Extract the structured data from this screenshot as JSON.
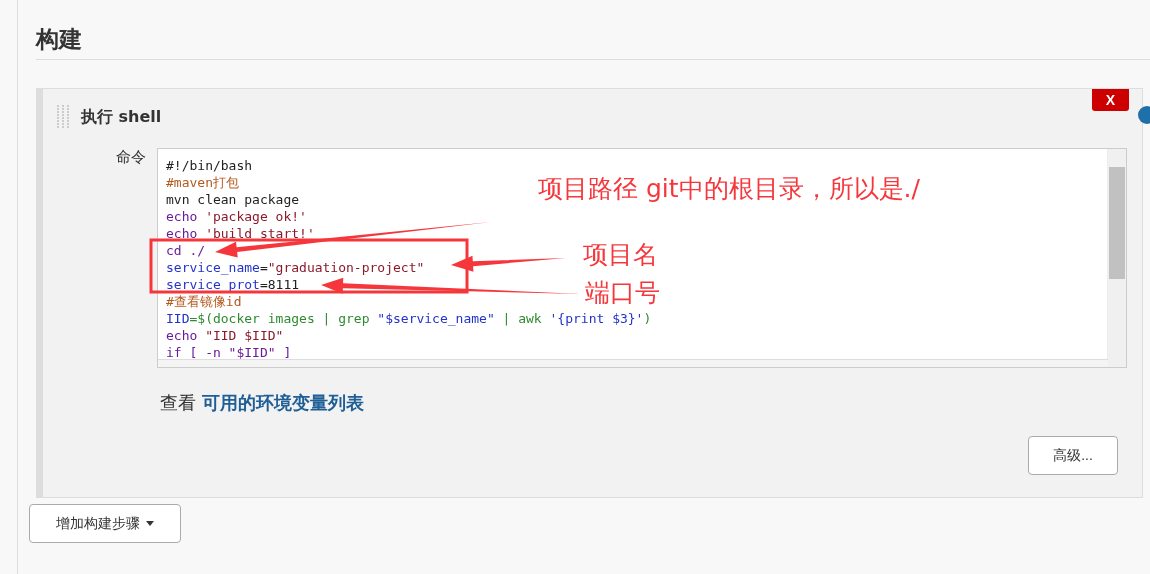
{
  "section": {
    "title": "构建"
  },
  "step": {
    "title": "执行 shell",
    "delete_label": "X",
    "command_label": "命令",
    "code": [
      [
        {
          "text": "#!/bin/bash",
          "kind": "plain"
        }
      ],
      [
        {
          "text": "#maven打包",
          "kind": "comment"
        }
      ],
      [
        {
          "text": "mvn clean package",
          "kind": "plain"
        }
      ],
      [
        {
          "text": "echo ",
          "kind": "keyword"
        },
        {
          "text": "'package ok!'",
          "kind": "string"
        }
      ],
      [
        {
          "text": "echo ",
          "kind": "keyword"
        },
        {
          "text": "'build start!'",
          "kind": "string"
        }
      ],
      [
        {
          "text": "cd ./",
          "kind": "keyword"
        }
      ],
      [
        {
          "text": "service_name",
          "kind": "variable"
        },
        {
          "text": "=",
          "kind": "plain"
        },
        {
          "text": "\"graduation-project\"",
          "kind": "string"
        }
      ],
      [
        {
          "text": "service_prot",
          "kind": "variable"
        },
        {
          "text": "=8111",
          "kind": "plain"
        }
      ],
      [
        {
          "text": "#查看镜像id",
          "kind": "comment"
        }
      ],
      [
        {
          "text": "IID",
          "kind": "variable"
        },
        {
          "text": "=$(docker images | grep ",
          "kind": "command"
        },
        {
          "text": "\"$service_name\"",
          "kind": "variable"
        },
        {
          "text": " | awk ",
          "kind": "command"
        },
        {
          "text": "'{print $3}'",
          "kind": "variable"
        },
        {
          "text": ")",
          "kind": "command"
        }
      ],
      [
        {
          "text": "echo ",
          "kind": "keyword"
        },
        {
          "text": "\"IID $IID\"",
          "kind": "string"
        }
      ],
      [
        {
          "text": "if [ -n \"$IID\" ]",
          "kind": "keyword"
        }
      ]
    ],
    "env_prefix": "查看",
    "env_link": "可用的环境变量列表",
    "advanced_button": "高级..."
  },
  "add_step_button": "增加构建步骤",
  "annotations": [
    "项目路径 git中的根目录，所以是./",
    "项目名",
    "端口号"
  ]
}
